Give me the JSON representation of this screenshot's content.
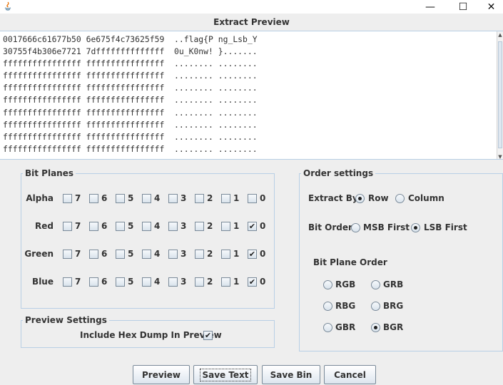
{
  "window": {
    "title": "",
    "minimize_glyph": "—",
    "maximize_glyph": "☐",
    "close_glyph": "✕"
  },
  "caption": "Extract Preview",
  "preview_lines": [
    "0017666c61677b50 6e675f4c73625f59  ..flag{P ng_Lsb_Y",
    "30755f4b306e7721 7dffffffffffffff  0u_K0nw! }.......",
    "ffffffffffffffff ffffffffffffffff  ........ ........",
    "ffffffffffffffff ffffffffffffffff  ........ ........",
    "ffffffffffffffff ffffffffffffffff  ........ ........",
    "ffffffffffffffff ffffffffffffffff  ........ ........",
    "ffffffffffffffff ffffffffffffffff  ........ ........",
    "ffffffffffffffff ffffffffffffffff  ........ ........",
    "ffffffffffffffff ffffffffffffffff  ........ ........",
    "ffffffffffffffff ffffffffffffffff  ........ ........"
  ],
  "bit_planes": {
    "title": "Bit Planes",
    "bits": [
      "7",
      "6",
      "5",
      "4",
      "3",
      "2",
      "1",
      "0"
    ],
    "channels": [
      {
        "label": "Alpha",
        "checked": [
          false,
          false,
          false,
          false,
          false,
          false,
          false,
          false
        ]
      },
      {
        "label": "Red",
        "checked": [
          false,
          false,
          false,
          false,
          false,
          false,
          false,
          true
        ]
      },
      {
        "label": "Green",
        "checked": [
          false,
          false,
          false,
          false,
          false,
          false,
          false,
          true
        ]
      },
      {
        "label": "Blue",
        "checked": [
          false,
          false,
          false,
          false,
          false,
          false,
          false,
          true
        ]
      }
    ]
  },
  "preview_settings": {
    "title": "Preview Settings",
    "hex_dump_label": "Include Hex Dump In Preview",
    "hex_dump_checked": true
  },
  "order_settings": {
    "title": "Order settings",
    "extract_by_label": "Extract By",
    "extract_by_options": [
      {
        "label": "Row",
        "selected": true
      },
      {
        "label": "Column",
        "selected": false
      }
    ],
    "bit_order_label": "Bit Order",
    "bit_order_options": [
      {
        "label": "MSB First",
        "selected": false
      },
      {
        "label": "LSB First",
        "selected": true
      }
    ],
    "plane_order_label": "Bit Plane Order",
    "plane_order_options": [
      {
        "label": "RGB",
        "selected": false
      },
      {
        "label": "GRB",
        "selected": false
      },
      {
        "label": "RBG",
        "selected": false
      },
      {
        "label": "BRG",
        "selected": false
      },
      {
        "label": "GBR",
        "selected": false
      },
      {
        "label": "BGR",
        "selected": true
      }
    ]
  },
  "check_glyph": "✔",
  "buttons": {
    "preview": "Preview",
    "save_text": "Save Text",
    "save_bin": "Save Bin",
    "cancel": "Cancel"
  }
}
